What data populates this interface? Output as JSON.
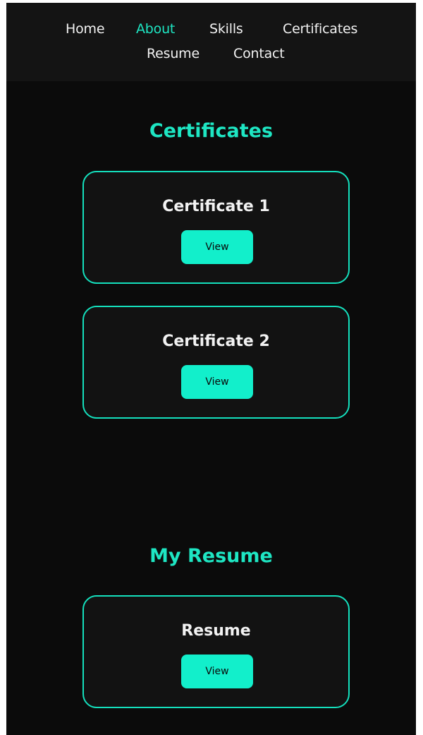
{
  "nav": {
    "items": [
      {
        "label": "Home"
      },
      {
        "label": "About"
      },
      {
        "label": "Skills"
      },
      {
        "label": "Certificates"
      },
      {
        "label": "Resume"
      },
      {
        "label": "Contact"
      }
    ],
    "active": "About"
  },
  "certificates": {
    "title": "Certificates",
    "cards": [
      {
        "title": "Certificate 1",
        "button": "View"
      },
      {
        "title": "Certificate 2",
        "button": "View"
      }
    ]
  },
  "resume": {
    "title": "My Resume",
    "card": {
      "title": "Resume",
      "button": "View"
    }
  },
  "colors": {
    "accent": "#1ee6c3",
    "button": "#12efcb",
    "background": "#0b0b0b",
    "navbar": "#141414",
    "card": "#121212"
  }
}
